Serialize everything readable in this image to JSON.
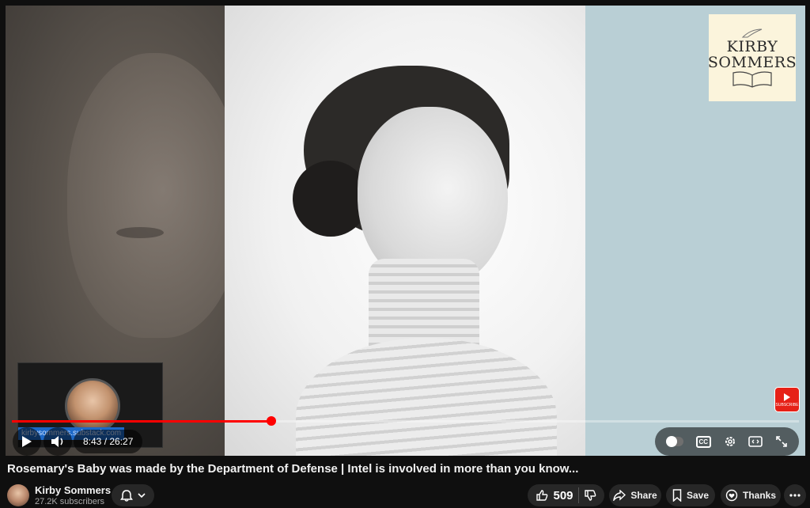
{
  "video": {
    "logo": {
      "line1": "KIRBY",
      "line2": "SOMMERS"
    },
    "watermark_label": "SUBSCRIBE",
    "inset_url": "kirbysommers.substack.com",
    "time": "8:43 / 26:27",
    "progress_fraction": 0.33,
    "controls": {
      "play_icon": "play-icon",
      "volume_icon": "volume-icon",
      "cc_label": "CC"
    }
  },
  "meta": {
    "title": "Rosemary's Baby was made by the Department of Defense | Intel is involved in more than you know...",
    "channel_name": "Kirby Sommers",
    "subscribers": "27.2K subscribers",
    "likes": "509",
    "share_label": "Share",
    "save_label": "Save",
    "thanks_label": "Thanks"
  },
  "colors": {
    "accent": "#ff0000",
    "background": "#0f0f0f",
    "player_bg": "#b9cfd5"
  }
}
